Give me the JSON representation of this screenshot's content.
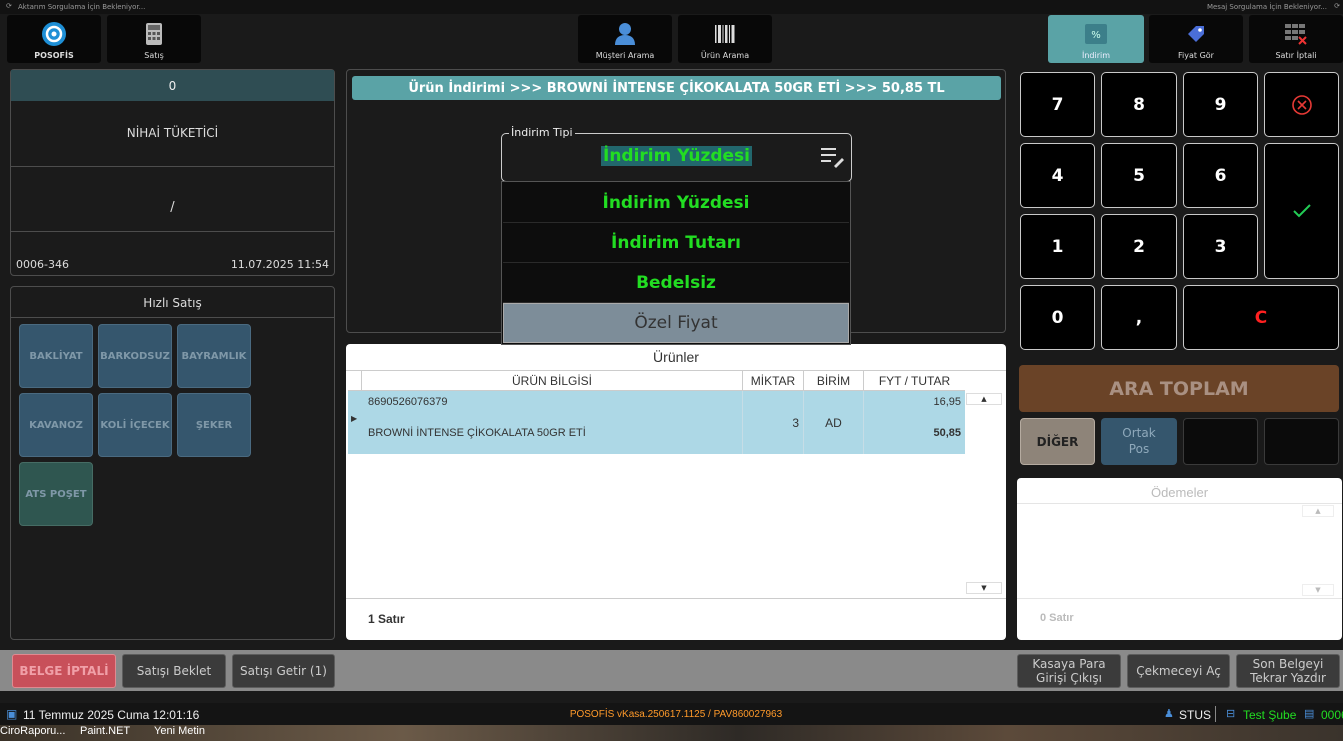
{
  "top_status": {
    "left": "Aktarım Sorgulama İçin Bekleniyor...",
    "right": "Mesaj Sorgulama İçin Bekleniyor..."
  },
  "toolbar": {
    "posofis": "POSOFİS",
    "satis": "Satış",
    "musteri_arama": "Müşteri Arama",
    "urun_arama": "Ürün Arama",
    "indirim": "İndirim",
    "fiyat_gor": "Fiyat Gör",
    "satir_iptali": "Satır İptali"
  },
  "customer": {
    "count": "0",
    "name": "NİHAİ TÜKETİCİ",
    "slash": "/",
    "doc_no": "0006-346",
    "datetime": "11.07.2025 11:54"
  },
  "quick_sale": {
    "title": "Hızlı Satış",
    "items": [
      "BAKLİYAT",
      "BARKODSUZ",
      "BAYRAMLIK",
      "KAVANOZ",
      "KOLİ İÇECEK",
      "ŞEKER",
      "ATS POŞET"
    ]
  },
  "discount": {
    "header": "Ürün İndirimi >>> BROWNİ İNTENSE ÇİKOKALATA 50GR ETİ >>> 50,85 TL",
    "type_label": "İndirim Tipi",
    "type_value": "İndirim Yüzdesi",
    "options": [
      "İndirim Yüzdesi",
      "İndirim Tutarı",
      "Bedelsiz",
      "Özel Fiyat"
    ]
  },
  "products": {
    "title": "Ürünler",
    "columns": [
      "ÜRÜN BİLGİSİ",
      "MİKTAR",
      "BİRİM",
      "FYT / TUTAR"
    ],
    "rows": [
      {
        "barcode": "8690526076379",
        "name": "BROWNİ İNTENSE ÇİKOKALATA 50GR ETİ",
        "qty": "3",
        "unit": "AD",
        "price": "16,95",
        "total": "50,85"
      }
    ],
    "footer": "1 Satır"
  },
  "keypad": {
    "k7": "7",
    "k8": "8",
    "k9": "9",
    "k4": "4",
    "k5": "5",
    "k6": "6",
    "k1": "1",
    "k2": "2",
    "k3": "3",
    "k0": "0",
    "comma": ",",
    "clear": "C"
  },
  "ara_toplam": "ARA TOPLAM",
  "diger": "DİĞER",
  "ortak_pos": "Ortak Pos",
  "payments": {
    "title": "Ödemeler",
    "footer": "0 Satır"
  },
  "bottom_buttons": {
    "belge_iptali": "BELGE İPTALİ",
    "satisi_beklet": "Satışı Beklet",
    "satisi_getir": "Satışı Getir (1)",
    "kasaya_para": "Kasaya Para Girişi Çıkışı",
    "cekmeceyi_ac": "Çekmeceyi Aç",
    "son_belge": "Son Belgeyi Tekrar Yazdır"
  },
  "status_bar": {
    "date": "11 Temmuz 2025 Cuma 12:01:16",
    "version": "POSOFİS vKasa.250617.1125 / PAV860027963",
    "user": "STUS",
    "branch": "Test Şube",
    "register": "0006"
  },
  "taskbar": {
    "items": [
      "CiroRaporu...",
      "Paint.NET",
      "Yeni Metin"
    ]
  },
  "colors": {
    "teal": "#5aa3a6",
    "green": "#22dd22",
    "belge_red": "#e05a5a",
    "ara_toplam_brown": "#6a4327",
    "row_selected": "#add8e6",
    "clear_red": "#ff2020"
  }
}
